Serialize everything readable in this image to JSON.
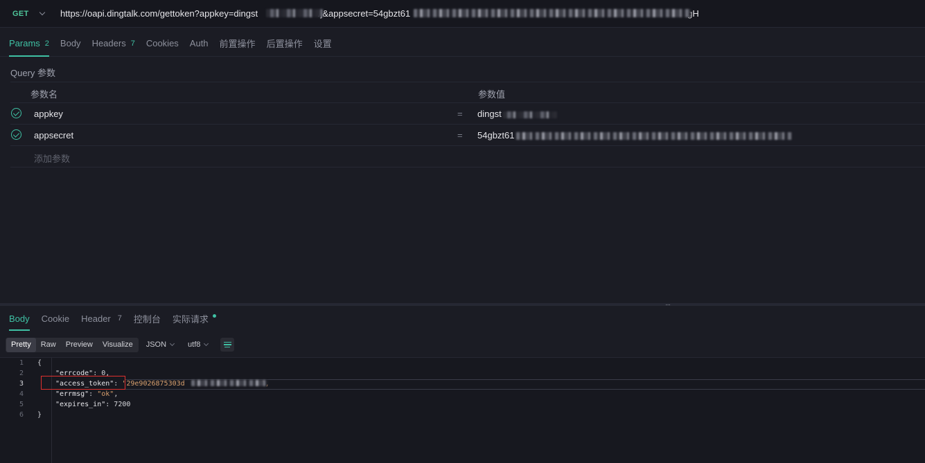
{
  "request": {
    "method": "GET",
    "url_prefix": "https://oapi.dingtalk.com/gettoken?appkey=dingst",
    "url_middle": "rj&appsecret=54gbzt61",
    "url_suffix": "gH"
  },
  "tabs": [
    {
      "label": "Params",
      "count": "2"
    },
    {
      "label": "Body",
      "count": ""
    },
    {
      "label": "Headers",
      "count": "7"
    },
    {
      "label": "Cookies",
      "count": ""
    },
    {
      "label": "Auth",
      "count": ""
    },
    {
      "label": "前置操作",
      "count": ""
    },
    {
      "label": "后置操作",
      "count": ""
    },
    {
      "label": "设置",
      "count": ""
    }
  ],
  "params": {
    "section_label": "Query 参数",
    "col_name": "参数名",
    "col_value": "参数值",
    "rows": [
      {
        "key": "appkey",
        "eq": "=",
        "value": "dingst"
      },
      {
        "key": "appsecret",
        "eq": "=",
        "value": "54gbzt61"
      }
    ],
    "add_placeholder": "添加参数"
  },
  "response": {
    "tabs": [
      {
        "label": "Body",
        "count": ""
      },
      {
        "label": "Cookie",
        "count": ""
      },
      {
        "label": "Header",
        "count": "7"
      },
      {
        "label": "控制台",
        "count": ""
      },
      {
        "label": "实际请求",
        "count": ""
      }
    ],
    "view_modes": [
      "Pretty",
      "Raw",
      "Preview",
      "Visualize"
    ],
    "format": "JSON",
    "encoding": "utf8",
    "lines": [
      {
        "num": "1",
        "text": "{"
      },
      {
        "num": "2",
        "key": "\"errcode\"",
        "sep": ": ",
        "val": "0",
        "tail": ","
      },
      {
        "num": "3",
        "key": "\"access_token\"",
        "sep": ": ",
        "val": "\"29e9026875303d",
        "tail": "\","
      },
      {
        "num": "4",
        "key": "\"errmsg\"",
        "sep": ": ",
        "val": "\"ok\"",
        "tail": ","
      },
      {
        "num": "5",
        "key": "\"expires_in\"",
        "sep": ": ",
        "val": "7200",
        "tail": ""
      },
      {
        "num": "6",
        "text": "}"
      }
    ]
  },
  "colors": {
    "accent": "#3fc1a4",
    "method": "#4ec59a",
    "highlight": "#e0302e",
    "background": "#1b1c24"
  }
}
